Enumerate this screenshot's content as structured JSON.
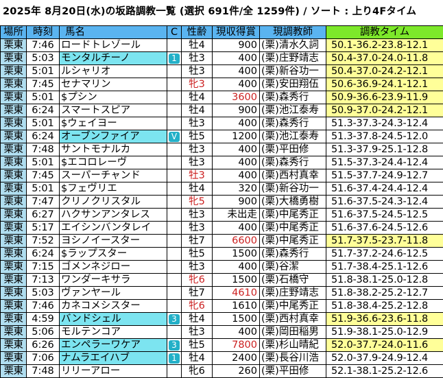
{
  "title": "2025年 8月20日(水)の坂路調教一覧  (選択 691件/全 1259件)  /  ソート : 上り4Fタイム",
  "headers": {
    "place": "場所",
    "time": "時刻",
    "horse": "馬名",
    "c": "C",
    "sexage": "性齢",
    "prize": "現収得賞",
    "trainer": "現調教師",
    "chokyo": "調教タイム"
  },
  "colors": {
    "header_blue": "#5ab4f0",
    "header_green": "#7de82a",
    "place_cell": "#b0def0",
    "horse_highlight": "#7ce4f0",
    "time_highlight": "#ffff99",
    "filly_red": "#cc2020",
    "badge": "#23b0c8"
  },
  "rows": [
    {
      "place": "栗東",
      "time": "7:46",
      "horse": "ロードトレゾール",
      "hl": false,
      "c": "",
      "sex": "牡4",
      "red": false,
      "prize": "900",
      "prize_red": false,
      "trainer": "(栗)清水久詞",
      "chokyo": "50.1-36.2-23.8-12.1",
      "yel": true
    },
    {
      "place": "栗東",
      "time": "5:03",
      "horse": "モンタルチーノ",
      "hl": true,
      "c": "1",
      "sex": "牡3",
      "red": false,
      "prize": "400",
      "prize_red": false,
      "trainer": "(栗)庄野靖志",
      "chokyo": "50.4-37.0-24.0-11.8",
      "yel": true
    },
    {
      "place": "栗東",
      "time": "5:01",
      "horse": "ルシャリオ",
      "hl": false,
      "c": "",
      "sex": "牡3",
      "red": false,
      "prize": "400",
      "prize_red": false,
      "trainer": "(栗)新谷功一",
      "chokyo": "50.4-37.0-24.2-12.1",
      "yel": true
    },
    {
      "place": "栗東",
      "time": "7:45",
      "horse": "セナマリン",
      "hl": false,
      "c": "",
      "sex": "牝3",
      "red": true,
      "prize": "400",
      "prize_red": false,
      "trainer": "(栗)安田翔伍",
      "chokyo": "50.6-36.9-24.1-12.1",
      "yel": true
    },
    {
      "place": "栗東",
      "time": "5:01",
      "horse": "$プシン",
      "hl": false,
      "c": "",
      "sex": "牡4",
      "red": false,
      "prize": "3600",
      "prize_red": true,
      "trainer": "(栗)森秀行",
      "chokyo": "50.9-36.6-23.9-11.9",
      "yel": true
    },
    {
      "place": "栗東",
      "time": "6:24",
      "horse": "スマートスピア",
      "hl": false,
      "c": "",
      "sex": "牡4",
      "red": false,
      "prize": "900",
      "prize_red": false,
      "trainer": "(栗)池江泰寿",
      "chokyo": "50.9-37.0-24.2-12.1",
      "yel": true
    },
    {
      "place": "栗東",
      "time": "5:01",
      "horse": "$ウェイヨー",
      "hl": false,
      "c": "",
      "sex": "牡3",
      "red": false,
      "prize": "400",
      "prize_red": false,
      "trainer": "(栗)森秀行",
      "chokyo": "51.3-37.3-24.3-12.4",
      "yel": false
    },
    {
      "place": "栗東",
      "time": "6:24",
      "horse": "オーブンファイア",
      "hl": true,
      "c": "V",
      "sex": "牡5",
      "red": false,
      "prize": "1200",
      "prize_red": false,
      "trainer": "(栗)池江泰寿",
      "chokyo": "51.3-37.8-24.5-12.0",
      "yel": false
    },
    {
      "place": "栗東",
      "time": "7:48",
      "horse": "サントモナルカ",
      "hl": false,
      "c": "",
      "sex": "牡3",
      "red": false,
      "prize": "400",
      "prize_red": false,
      "trainer": "(栗)平田修",
      "chokyo": "51.3-37.9-25.1-12.8",
      "yel": false
    },
    {
      "place": "栗東",
      "time": "5:01",
      "horse": "$エコロレーヴ",
      "hl": false,
      "c": "",
      "sex": "牡3",
      "red": false,
      "prize": "400",
      "prize_red": false,
      "trainer": "(栗)森秀行",
      "chokyo": "51.5-37.3-24.4-12.4",
      "yel": false
    },
    {
      "place": "栗東",
      "time": "7:45",
      "horse": "スーパーチャンド",
      "hl": false,
      "c": "",
      "sex": "牡3",
      "red": true,
      "prize": "400",
      "prize_red": false,
      "trainer": "(栗)西村真幸",
      "chokyo": "51.5-37.7-24.9-12.7",
      "yel": false
    },
    {
      "place": "栗東",
      "time": "5:01",
      "horse": "$フェヴリエ",
      "hl": false,
      "c": "",
      "sex": "牡4",
      "red": false,
      "prize": "320",
      "prize_red": false,
      "trainer": "(栗)新谷功一",
      "chokyo": "51.6-37.4-24.4-12.4",
      "yel": false
    },
    {
      "place": "栗東",
      "time": "7:47",
      "horse": "クリノクリスタル",
      "hl": false,
      "c": "",
      "sex": "牝5",
      "red": true,
      "prize": "900",
      "prize_red": false,
      "trainer": "(栗)大橋勇樹",
      "chokyo": "51.6-37.5-24.3-12.4",
      "yel": false
    },
    {
      "place": "栗東",
      "time": "6:27",
      "horse": "ハクサンアンタレス",
      "hl": false,
      "c": "",
      "sex": "牡3",
      "red": false,
      "prize": "未出走",
      "prize_red": false,
      "trainer": "(栗)中尾秀正",
      "chokyo": "51.6-37.5-24.5-12.5",
      "yel": false
    },
    {
      "place": "栗東",
      "time": "5:17",
      "horse": "エイシンバンタレイ",
      "hl": false,
      "c": "",
      "sex": "牡3",
      "red": false,
      "prize": "400",
      "prize_red": false,
      "trainer": "(栗)中尾秀正",
      "chokyo": "51.6-37.6-24.5-12.6",
      "yel": false
    },
    {
      "place": "栗東",
      "time": "7:52",
      "horse": "ヨシノイースター",
      "hl": false,
      "c": "",
      "sex": "牡7",
      "red": false,
      "prize": "6600",
      "prize_red": true,
      "trainer": "(栗)中尾秀正",
      "chokyo": "51.7-37.5-23.7-11.8",
      "yel": true
    },
    {
      "place": "栗東",
      "time": "6:24",
      "horse": "$ラップスター",
      "hl": false,
      "c": "",
      "sex": "牡5",
      "red": false,
      "prize": "1500",
      "prize_red": false,
      "trainer": "(栗)森秀行",
      "chokyo": "51.7-37.2-24.6-12.5",
      "yel": false
    },
    {
      "place": "栗東",
      "time": "7:15",
      "horse": "ゴメンネジロー",
      "hl": false,
      "c": "",
      "sex": "牡3",
      "red": false,
      "prize": "400",
      "prize_red": false,
      "trainer": "(栗)谷潔",
      "chokyo": "51.7-38.4-25.1-12.6",
      "yel": false
    },
    {
      "place": "栗東",
      "time": "7:13",
      "horse": "ワンダーキサラ",
      "hl": false,
      "c": "",
      "sex": "牝6",
      "red": true,
      "prize": "1500",
      "prize_red": false,
      "trainer": "(栗)石橋守",
      "chokyo": "51.8-38.1-25.0-12.8",
      "yel": false
    },
    {
      "place": "栗東",
      "time": "5:03",
      "horse": "ヴァンヤール",
      "hl": false,
      "c": "",
      "sex": "牡7",
      "red": false,
      "prize": "4610",
      "prize_red": true,
      "trainer": "(栗)庄野靖志",
      "chokyo": "51.8-38.2-25.2-12.7",
      "yel": false
    },
    {
      "place": "栗東",
      "time": "7:46",
      "horse": "カネコメシスター",
      "hl": false,
      "c": "",
      "sex": "牝6",
      "red": true,
      "prize": "1610",
      "prize_red": false,
      "trainer": "(栗)中尾秀正",
      "chokyo": "51.8-38.4-25.2-12.8",
      "yel": false
    },
    {
      "place": "栗東",
      "time": "4:59",
      "horse": "バンドシェル",
      "hl": true,
      "c": "3",
      "sex": "牡4",
      "red": false,
      "prize": "1500",
      "prize_red": false,
      "trainer": "(栗)西村真幸",
      "chokyo": "51.9-36.6-23.6-11.8",
      "yel": true
    },
    {
      "place": "栗東",
      "time": "5:06",
      "horse": "モルテンコア",
      "hl": false,
      "c": "",
      "sex": "牡3",
      "red": false,
      "prize": "400",
      "prize_red": false,
      "trainer": "(栗)岡田稲男",
      "chokyo": "51.9-38.1-25.0-12.9",
      "yel": false
    },
    {
      "place": "栗東",
      "time": "6:26",
      "horse": "エンペラーワケア",
      "hl": true,
      "c": "3",
      "sex": "牡5",
      "red": false,
      "prize": "7800",
      "prize_red": true,
      "trainer": "(栗)杉山晴紀",
      "chokyo": "52.0-37.7-24.0-11.6",
      "yel": true
    },
    {
      "place": "栗東",
      "time": "7:06",
      "horse": "ナムラエイハブ",
      "hl": true,
      "c": "1",
      "sex": "牡4",
      "red": false,
      "prize": "2400",
      "prize_red": false,
      "trainer": "(栗)長谷川浩",
      "chokyo": "52.0-37.9-24.9-12.4",
      "yel": false
    },
    {
      "place": "栗東",
      "time": "7:48",
      "horse": "リリーアロー",
      "hl": false,
      "c": "",
      "sex": "牝6",
      "red": false,
      "prize": "260",
      "prize_red": false,
      "trainer": "(栗)平田修",
      "chokyo": "52.1-38.1-25.2-12.6",
      "yel": false
    }
  ]
}
